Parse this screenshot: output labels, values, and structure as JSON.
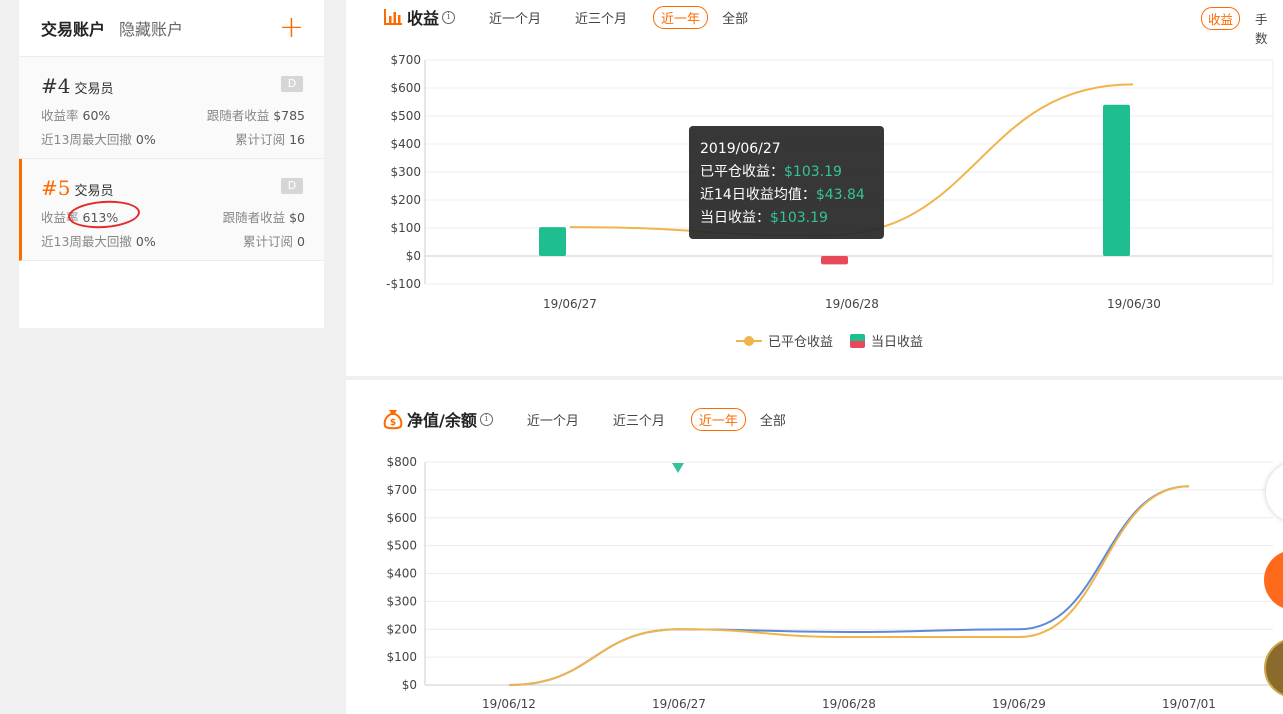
{
  "sidebar": {
    "tabs": [
      "交易账户",
      "隐藏账户"
    ],
    "add_icon": "+",
    "accounts": [
      {
        "num": "#4",
        "name": "交易员",
        "badge": "D",
        "yield_label": "收益率",
        "yield": "60%",
        "follower_label": "跟随者收益",
        "follower": "$785",
        "drawdown_label": "近13周最大回撤",
        "drawdown": "0%",
        "subs_label": "累计订阅",
        "subs": "16"
      },
      {
        "num": "#5",
        "name": "交易员",
        "badge": "D",
        "yield_label": "收益率",
        "yield": "613%",
        "follower_label": "跟随者收益",
        "follower": "$0",
        "drawdown_label": "近13周最大回撤",
        "drawdown": "0%",
        "subs_label": "累计订阅",
        "subs": "0"
      }
    ]
  },
  "profit": {
    "title": "收益",
    "filters": [
      "近一个月",
      "近三个月",
      "近一年",
      "全部"
    ],
    "active_filter": "近一年",
    "right_tabs": [
      "收益",
      "手数"
    ],
    "tooltip": {
      "date": "2019/06/27",
      "line1_label": "已平仓收益：",
      "line1_value": "$103.19",
      "line2_label": "近14日收益均值：",
      "line2_value": "$43.84",
      "line3_label": "当日收益：",
      "line3_value": "$103.19"
    },
    "legend": [
      "已平仓收益",
      "当日收益"
    ]
  },
  "equity": {
    "title": "净值/余额",
    "filters": [
      "近一个月",
      "近三个月",
      "近一年",
      "全部"
    ],
    "active_filter": "近一年"
  },
  "chart_data": [
    {
      "type": "bar",
      "categories": [
        "19/06/27",
        "19/06/28",
        "19/06/30"
      ],
      "series": [
        {
          "name": "当日收益",
          "values": [
            103.19,
            -30,
            540
          ]
        },
        {
          "name": "已平仓收益",
          "values": [
            103.19,
            73,
            613
          ]
        }
      ],
      "ylim": [
        -100,
        700
      ],
      "yticks": [
        "$700",
        "$600",
        "$500",
        "$400",
        "$300",
        "$200",
        "$100",
        "$0",
        "-$100"
      ],
      "colors": {
        "up": "#1fbe90",
        "down": "#e8485a",
        "line": "#f0b44c"
      }
    },
    {
      "type": "line",
      "x": [
        "19/06/12",
        "19/06/27",
        "19/06/28",
        "19/06/29",
        "19/07/01"
      ],
      "series": [
        {
          "values": [
            0,
            200,
            190,
            200,
            713
          ],
          "color": "#5b8ad6"
        },
        {
          "values": [
            0,
            200,
            172,
            172,
            713
          ],
          "color": "#f0b44c"
        }
      ],
      "ylim": [
        0,
        800
      ],
      "yticks": [
        "$800",
        "$700",
        "$600",
        "$500",
        "$400",
        "$300",
        "$200",
        "$100",
        "$0"
      ]
    }
  ]
}
